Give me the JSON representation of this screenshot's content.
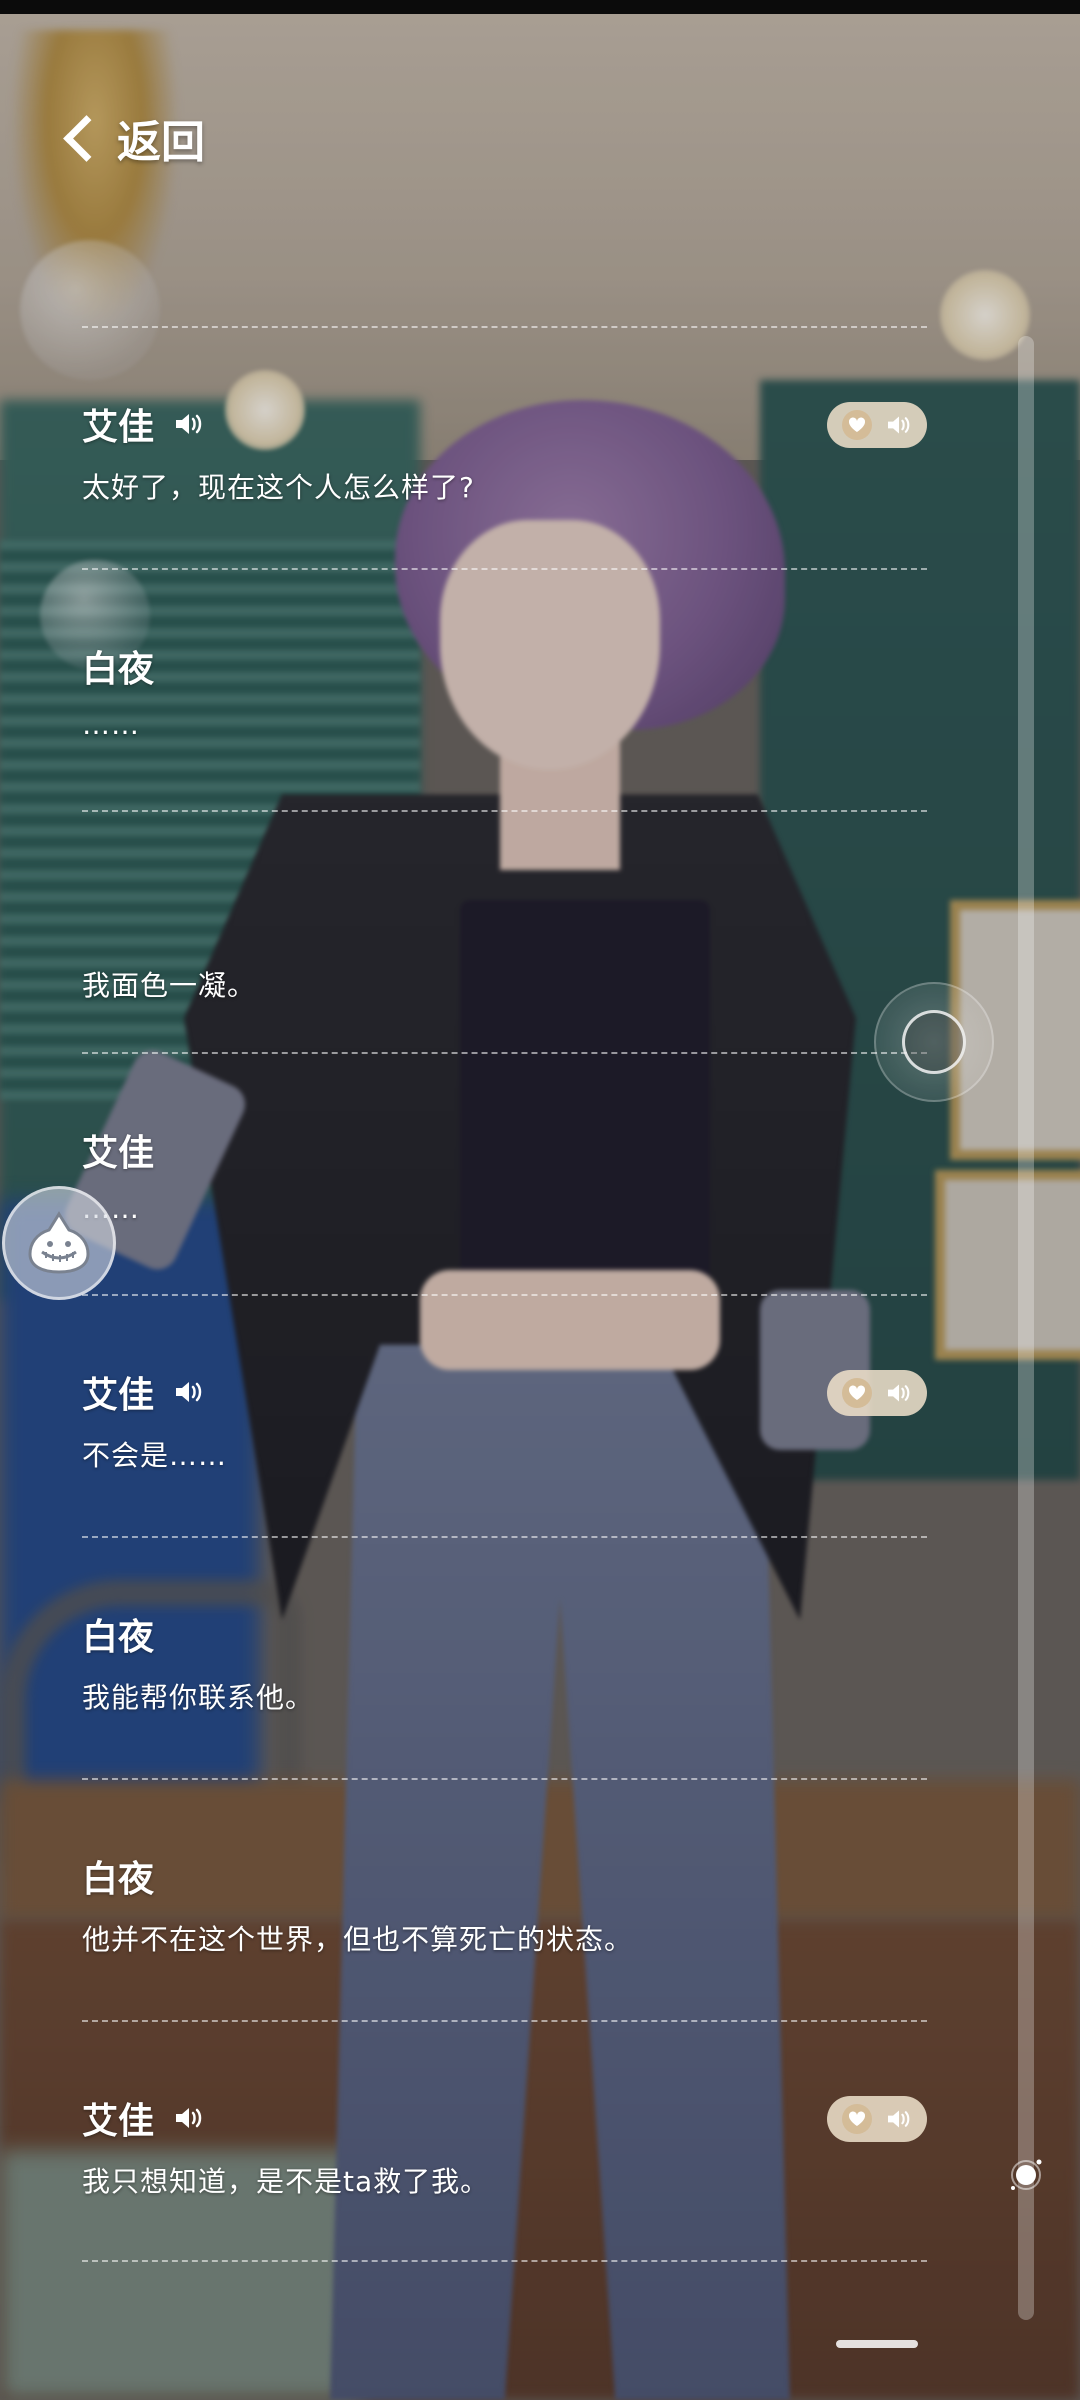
{
  "header": {
    "back_label": "返回"
  },
  "log": [
    {
      "speaker": "艾佳",
      "text": "太好了，现在这个人怎么样了?",
      "has_voice": true
    },
    {
      "speaker": "白夜",
      "text": "……",
      "has_voice": false
    },
    {
      "speaker": "",
      "text": "我面色一凝。",
      "has_voice": false
    },
    {
      "speaker": "艾佳",
      "text": "……",
      "has_voice": false
    },
    {
      "speaker": "艾佳",
      "text": "不会是……",
      "has_voice": true
    },
    {
      "speaker": "白夜",
      "text": "我能帮你联系他。",
      "has_voice": false
    },
    {
      "speaker": "白夜",
      "text": "他并不在这个世界，但也不算死亡的状态。",
      "has_voice": false
    },
    {
      "speaker": "艾佳",
      "text": "我只想知道，是不是ta救了我。",
      "has_voice": true
    }
  ],
  "icons": {
    "back": "chevron-left-icon",
    "speaker": "speaker-icon",
    "favorite": "heart-icon",
    "replay": "speaker-icon"
  },
  "colors": {
    "pill_bg": "#ecdec8",
    "heart_bg": "#d4bc98",
    "divider": "rgba(255,255,255,.55)"
  }
}
